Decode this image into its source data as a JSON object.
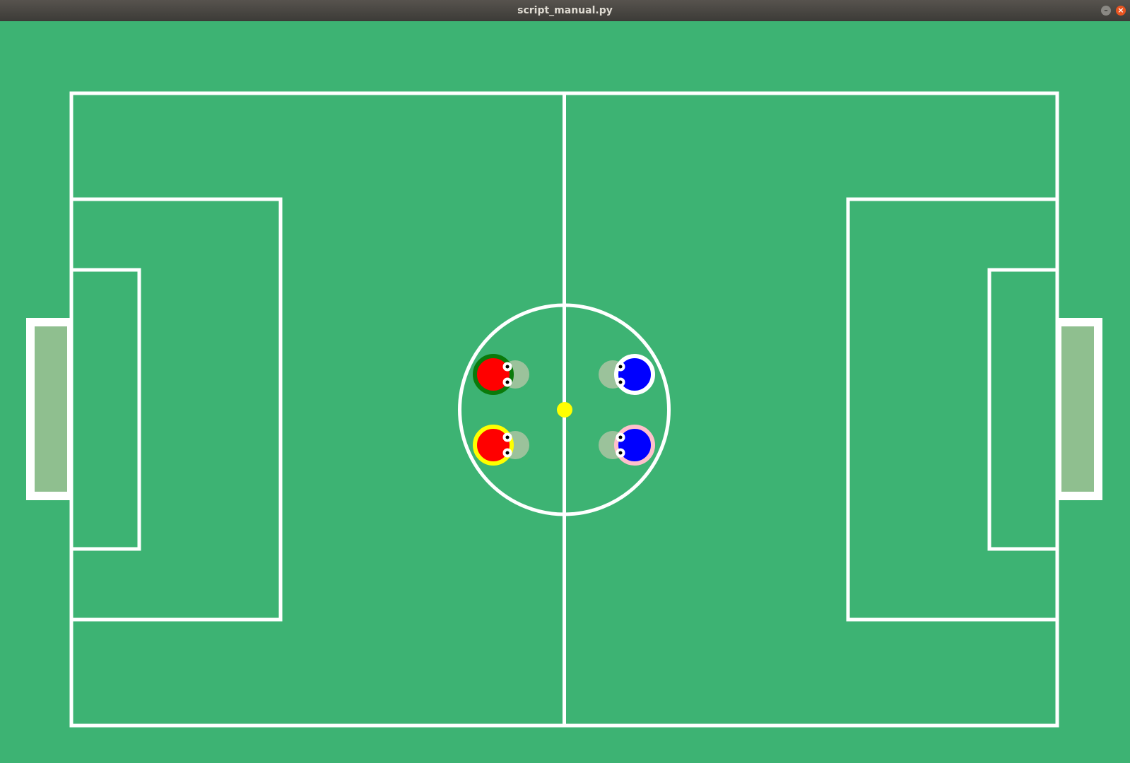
{
  "window": {
    "title": "script_manual.py",
    "minimize_glyph": "–",
    "close_glyph": "×"
  },
  "colors": {
    "grass": "#3db373",
    "lines": "#ffffff",
    "goal_fill": "#8fbf8f",
    "ball": "#ffff00",
    "red_team": "#ff0000",
    "blue_team": "#0000ff",
    "player_shadow": "#9bc29b"
  },
  "scene": {
    "ball": {
      "color": "yellow"
    },
    "players": [
      {
        "team": "red",
        "ring_color": "#0a7a0a",
        "facing": "right"
      },
      {
        "team": "red",
        "ring_color": "#ffff00",
        "facing": "right"
      },
      {
        "team": "blue",
        "ring_color": "#ffffff",
        "facing": "left"
      },
      {
        "team": "blue",
        "ring_color": "#ffc0cb",
        "facing": "left"
      }
    ]
  }
}
